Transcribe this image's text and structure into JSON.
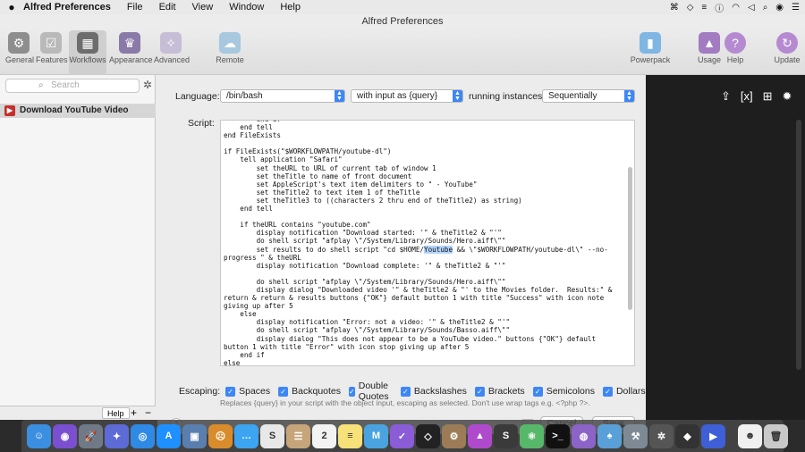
{
  "menubar": {
    "app_name": "Alfred Preferences",
    "items": [
      "File",
      "Edit",
      "View",
      "Window",
      "Help"
    ]
  },
  "window": {
    "title": "Alfred Preferences"
  },
  "toolbar": {
    "left": [
      {
        "label": "General",
        "icon": "gear-icon",
        "color": "#8e8e8e"
      },
      {
        "label": "Features",
        "icon": "checkbox-icon",
        "color": "#a9a9a9"
      },
      {
        "label": "Workflows",
        "icon": "grid-icon",
        "color": "#6d6d6d"
      },
      {
        "label": "Appearance",
        "icon": "tuxedo-icon",
        "color": "#8a7aa8"
      },
      {
        "label": "Advanced",
        "icon": "advanced-icon",
        "color": "#b9b0c9"
      },
      {
        "label": "Remote",
        "icon": "remote-icon",
        "color": "#8db7d1"
      }
    ],
    "right": [
      {
        "label": "Powerpack",
        "icon": "powerpack-icon",
        "color": "#7fb6e3"
      },
      {
        "label": "Usage",
        "icon": "usage-icon",
        "color": "#a27bc1"
      },
      {
        "label": "Help",
        "icon": "help-icon",
        "color": "#b58ad1"
      },
      {
        "label": "Update",
        "icon": "update-icon",
        "color": "#b58ad1"
      }
    ]
  },
  "sidebar": {
    "search_placeholder": "Search",
    "workflow": "Download YouTube Video",
    "help_label": "Help"
  },
  "sheet": {
    "language_label": "Language:",
    "language_value": "/bin/bash",
    "input_value": "with input as {query}",
    "running_label": "running instances",
    "running_value": "Sequentially",
    "script_label": "Script:",
    "script_lines": [
      "        end if",
      "    end tell",
      "end FileExists",
      "",
      "if FileExists(\"$WORKFLOWPATH/youtube-dl\")",
      "    tell application \"Safari\"",
      "        set theURL to URL of current tab of window 1",
      "        set theTitle to name of front document",
      "        set AppleScript's text item delimiters to \" - YouTube\"",
      "        set theTitle2 to text item 1 of theTitle",
      "        set theTitle3 to ((characters 2 thru end of theTitle2) as string)",
      "    end tell",
      "",
      "    if theURL contains \"youtube.com\"",
      "        display notification \"Download started: '\" & theTitle2 & \"'\"",
      "        do shell script \"afplay \\\"/System/Library/Sounds/Hero.aiff\\\"\"",
      "        set results to do shell script \"cd $HOME/Youtube && \\\"$WORKFLOWPATH/youtube-dl\\\" --no-",
      "progress \" & theURL",
      "        display notification \"Download complete: '\" & theTitle2 & \"'\"",
      "",
      "        do shell script \"afplay \\\"/System/Library/Sounds/Hero.aiff\\\"\"",
      "        display dialog \"Downloaded video '\" & theTitle2 & \"' to the Movies folder.  Results:\" &",
      "return & return & results buttons {\"OK\"} default button 1 with title \"Success\" with icon note",
      "giving up after 5",
      "    else",
      "        display notification \"Error: not a video: '\" & theTitle2 & \"'\"",
      "        do shell script \"afplay \\\"/System/Library/Sounds/Basso.aiff\\\"\"",
      "        display dialog \"This does not appear to be a YouTube video.\" buttons {\"OK\"} default",
      "button 1 with title \"Error\" with icon stop giving up after 5",
      "    end if",
      "else"
    ],
    "highlight_word": "Youtube",
    "escaping_label": "Escaping:",
    "escaping": [
      "Spaces",
      "Backquotes",
      "Double Quotes",
      "Backslashes",
      "Brackets",
      "Semicolons",
      "Dollars"
    ],
    "hint": "Replaces {query} in your script with the object input, escaping as selected. Don't use wrap tags e.g. <?php ?>.",
    "cancel_label": "Cancel",
    "save_label": "Save"
  },
  "dock": [
    {
      "name": "finder-icon",
      "color": "#3b8fe0",
      "glyph": "☺"
    },
    {
      "name": "siri-icon",
      "color": "#7a4fd0",
      "glyph": "◉"
    },
    {
      "name": "launchpad-icon",
      "color": "#6f7a86",
      "glyph": "🚀"
    },
    {
      "name": "photo-app-icon",
      "color": "#5c6bd6",
      "glyph": "✦"
    },
    {
      "name": "safari-icon",
      "color": "#2f8ae6",
      "glyph": "◎"
    },
    {
      "name": "app-store-icon",
      "color": "#1e90ff",
      "glyph": "A"
    },
    {
      "name": "preview-icon",
      "color": "#5a7fae",
      "glyph": "▣"
    },
    {
      "name": "scream-icon",
      "color": "#d98c2b",
      "glyph": "☹"
    },
    {
      "name": "messages-icon",
      "color": "#3ca4f0",
      "glyph": "…"
    },
    {
      "name": "s-app-icon",
      "color": "#e8e8e8",
      "glyph": "S"
    },
    {
      "name": "contacts-icon",
      "color": "#c7a57a",
      "glyph": "☰"
    },
    {
      "name": "calendar-icon",
      "color": "#f3f3f3",
      "glyph": "2"
    },
    {
      "name": "notes-icon",
      "color": "#f7e27a",
      "glyph": "≡"
    },
    {
      "name": "markdown-icon",
      "color": "#4aa3df",
      "glyph": "M"
    },
    {
      "name": "omnifocus-icon",
      "color": "#8a5cd6",
      "glyph": "✓"
    },
    {
      "name": "alfred-icon",
      "color": "#222222",
      "glyph": "◇"
    },
    {
      "name": "git-icon",
      "color": "#9b7c57",
      "glyph": "⚙"
    },
    {
      "name": "prism-icon",
      "color": "#b04acc",
      "glyph": "▲"
    },
    {
      "name": "sublime-icon",
      "color": "#3a3a3a",
      "glyph": "S"
    },
    {
      "name": "atom-icon",
      "color": "#58b86a",
      "glyph": "⚛"
    },
    {
      "name": "terminal-icon",
      "color": "#111111",
      "glyph": ">_"
    },
    {
      "name": "tor-icon",
      "color": "#8c63c7",
      "glyph": "◍"
    },
    {
      "name": "elephant-icon",
      "color": "#5aa0d8",
      "glyph": "♠"
    },
    {
      "name": "tools-icon",
      "color": "#7d8a96",
      "glyph": "⚒"
    },
    {
      "name": "wheel-icon",
      "color": "#555555",
      "glyph": "✲"
    },
    {
      "name": "hat-icon",
      "color": "#333333",
      "glyph": "◆"
    },
    {
      "name": "screenflow-icon",
      "color": "#3f5fd6",
      "glyph": "▶"
    },
    {
      "name": "avatar-icon",
      "color": "#f0f0f0",
      "glyph": "☻"
    },
    {
      "name": "trash-icon",
      "color": "#c9c9c9",
      "glyph": "🗑"
    }
  ]
}
